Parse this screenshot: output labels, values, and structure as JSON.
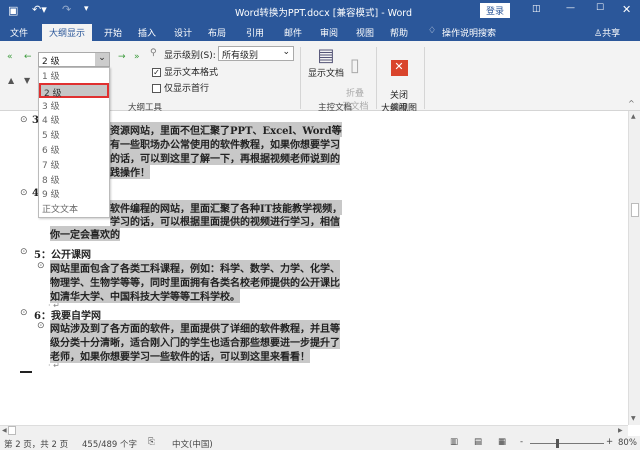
{
  "titlebar": {
    "title": "Word转换为PPT.docx [兼容模式] - Word",
    "login": "登录",
    "icons": [
      "save-icon",
      "undo-icon",
      "redo-icon",
      "customize-icon",
      "ribbon-display-icon",
      "minimize-icon",
      "maximize-icon",
      "close-icon"
    ]
  },
  "tabs": [
    "文件",
    "大纲显示",
    "开始",
    "插入",
    "设计",
    "布局",
    "引用",
    "邮件",
    "审阅",
    "视图",
    "帮助"
  ],
  "tell_me": "操作说明搜索",
  "share": "共享",
  "ribbon": {
    "level_combo": "2 级",
    "show_level_label": "显示级别(S):",
    "show_level_value": "所有级别",
    "show_text_format": "显示文本格式",
    "show_text_format_checked": true,
    "show_first_line": "仅显示首行",
    "show_first_line_checked": false,
    "outline_tools": "大纲工具",
    "show_document": "显示文档",
    "collapse_sub": "折叠\n子文档",
    "master_doc": "主控文档",
    "close_outline": "关闭\n大纲视图",
    "close_group": "关闭"
  },
  "dropdown": [
    "1 级",
    "2 级",
    "3 级",
    "4 级",
    "5 级",
    "6 级",
    "7 级",
    "8 级",
    "9 级",
    "正文文本"
  ],
  "dropdown_selected": 1,
  "doc": {
    "s3": {
      "bullet": "3",
      "lines": [
        "资源网站，里面不但汇聚了PPT、Excel、Word等",
        "有一些职场办公常使用的软件教程，如果你想要学习",
        "的话，可以到这里了解一下，再根据视频老师说到的",
        "践操作！"
      ]
    },
    "s4": {
      "bullet": "4",
      "lines": [
        "软件编程的网站，里面汇聚了各种IT技能教学视频，",
        "学习的话，可以根据里面提供的视频进行学习，相信",
        "你一定会喜欢的"
      ]
    },
    "s5": {
      "heading": "5：公开课网",
      "lines": [
        "网站里面包含了各类工科课程，例如：科学、数学、力学、化学、",
        "物理学、生物学等等，同时里面拥有各类名校老师提供的公开课比",
        "如清华大学、中国科技大学等等工科学校。"
      ]
    },
    "s6": {
      "heading": "6：我要自学网",
      "lines": [
        "网站涉及到了各方面的软件，里面提供了详细的软件教程，并且等",
        "级分类十分清晰，适合刚入门的学生也适合那些想要进一步提升了",
        "老师，如果你想要学习一些软件的话，可以到这里来看看！"
      ]
    }
  },
  "status": {
    "page": "第 2 页，共 2 页",
    "words": "455/489 个字",
    "lang": "中文(中国)",
    "zoom": "80%",
    "zoom_percent": 80
  }
}
